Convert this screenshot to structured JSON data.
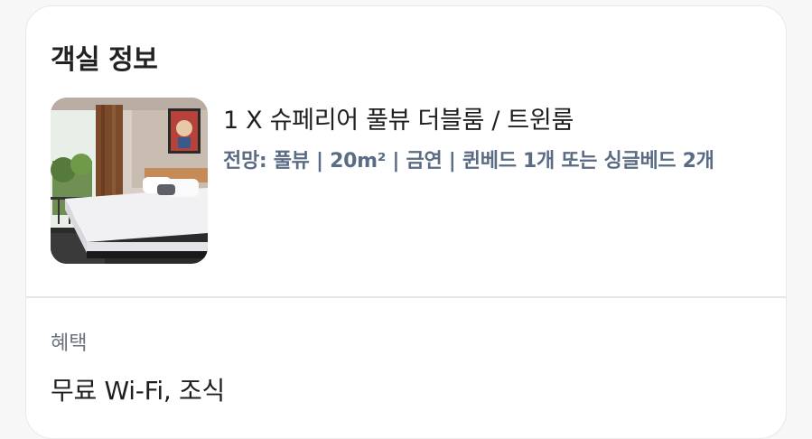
{
  "room_info": {
    "title": "객실 정보",
    "room": {
      "name": "1 X 슈페리어 풀뷰 더블룸 / 트윈룸",
      "details": "전망: 풀뷰 | 20m² | 금연 | 퀸베드 1개 또는 싱글베드 2개",
      "photo_icon": "room-photo"
    }
  },
  "benefits": {
    "label": "혜택",
    "value": "무료 Wi-Fi, 조식"
  }
}
